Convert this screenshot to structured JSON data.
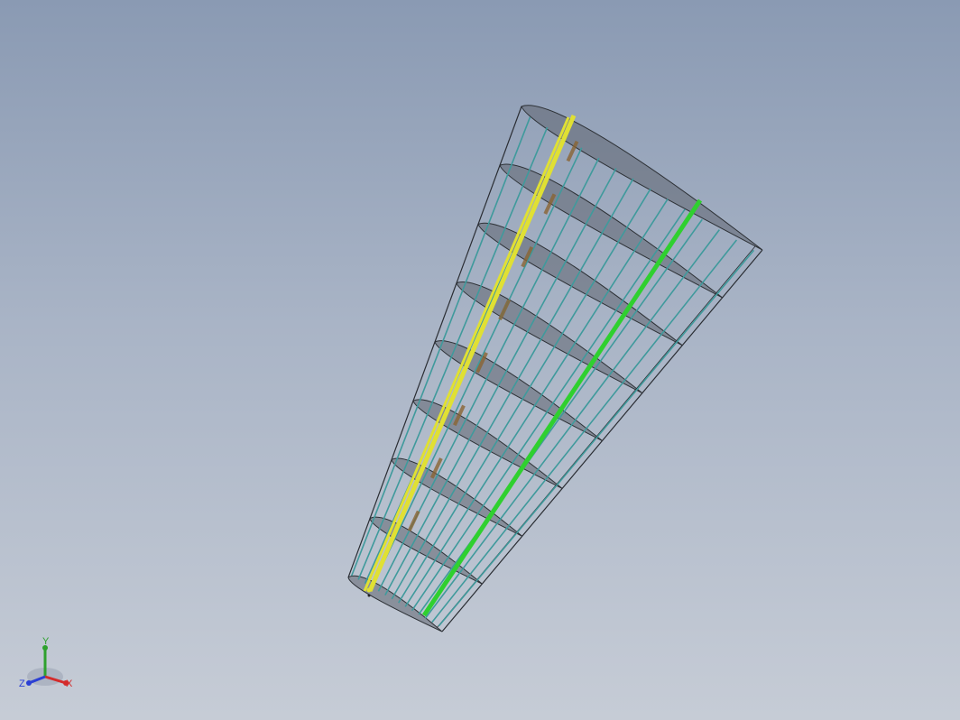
{
  "view": {
    "background_top": "#8a9ab3",
    "background_bottom": "#c6ccd6"
  },
  "model": {
    "colors": {
      "rib_fill": "#5e6470",
      "rib_edge": "#2d3136",
      "stringer": "#3f9a9c",
      "front_spar": "#e0e033",
      "rear_spar": "#2fd02f",
      "skin_edge": "#2a2d33",
      "brace": "#8a6432"
    }
  },
  "triad": {
    "x_label": "X",
    "y_label": "Y",
    "z_label": "Z",
    "x_color": "#d42b2b",
    "y_color": "#2ea12e",
    "z_color": "#2b3fd4"
  }
}
